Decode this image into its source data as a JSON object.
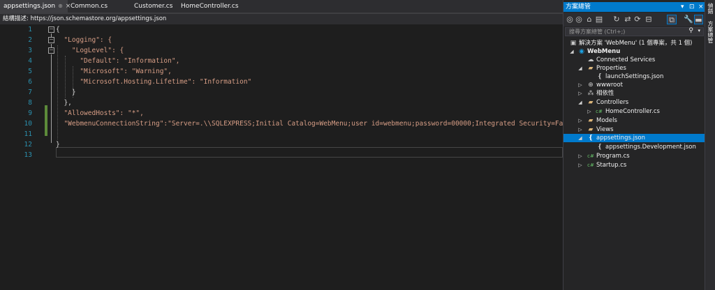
{
  "tabs": [
    {
      "label": "appsettings.json",
      "active": true
    },
    {
      "label": "Common.cs"
    },
    {
      "label": "Customer.cs"
    },
    {
      "label": "HomeController.cs"
    }
  ],
  "tab_pin_glyph": "⊕",
  "tab_close_glyph": "×",
  "schema": "結構描述:  https://json.schemastore.org/appsettings.json",
  "editor": {
    "line_numbers": [
      "1",
      "2",
      "3",
      "4",
      "5",
      "6",
      "7",
      "8",
      "9",
      "10",
      "11",
      "12",
      "13"
    ],
    "lines": [
      "{",
      "  \"Logging\": {",
      "    \"LogLevel\": {",
      "      \"Default\": \"Information\",",
      "      \"Microsoft\": \"Warning\",",
      "      \"Microsoft.Hosting.Lifetime\": \"Information\"",
      "    }",
      "  },",
      "  \"AllowedHosts\": \"*\",",
      "  \"WebmenuConnectionString\":\"Server=.\\\\SQLEXPRESS;Initial Catalog=WebMenu;user id=webmenu;password=00000;Integrated Security=False\"",
      "",
      "}",
      ""
    ]
  },
  "solution_explorer": {
    "title": "方案總管",
    "title_buttons": [
      "▾",
      "⊡",
      "×"
    ],
    "search_placeholder": "搜尋方案總管 (Ctrl+;)",
    "tree": [
      {
        "label": "解決方案 'WebMenu' (1 個專案，共 1 個)",
        "icon": "solution-icon",
        "depth": 0,
        "arrow": ""
      },
      {
        "label": "WebMenu",
        "icon": "web-project-icon",
        "depth": 1,
        "arrow": "◢",
        "bold": true
      },
      {
        "label": "Connected Services",
        "icon": "connected-services-icon",
        "depth": 2,
        "arrow": ""
      },
      {
        "label": "Properties",
        "icon": "properties-folder-icon",
        "depth": 2,
        "arrow": "◢"
      },
      {
        "label": "launchSettings.json",
        "icon": "json-file-icon",
        "depth": 3,
        "arrow": ""
      },
      {
        "label": "wwwroot",
        "icon": "globe-icon",
        "depth": 2,
        "arrow": "▷"
      },
      {
        "label": "相依性",
        "icon": "dependencies-icon",
        "depth": 2,
        "arrow": "▷"
      },
      {
        "label": "Controllers",
        "icon": "folder-icon",
        "depth": 2,
        "arrow": "◢"
      },
      {
        "label": "HomeController.cs",
        "icon": "csharp-file-icon",
        "depth": 3,
        "arrow": "▷"
      },
      {
        "label": "Models",
        "icon": "folder-icon",
        "depth": 2,
        "arrow": "▷"
      },
      {
        "label": "Views",
        "icon": "folder-icon",
        "depth": 2,
        "arrow": "▷"
      },
      {
        "label": "appsettings.json",
        "icon": "json-file-icon",
        "depth": 2,
        "arrow": "◢",
        "selected": true
      },
      {
        "label": "appsettings.Development.json",
        "icon": "json-file-icon",
        "depth": 3,
        "arrow": ""
      },
      {
        "label": "Program.cs",
        "icon": "csharp-file-icon",
        "depth": 2,
        "arrow": "▷"
      },
      {
        "label": "Startup.cs",
        "icon": "csharp-file-icon",
        "depth": 2,
        "arrow": "▷"
      }
    ]
  },
  "side_tabs": [
    "偵錯",
    "方案總管"
  ],
  "colors": {
    "accent": "#007acc",
    "editor_bg": "#1e1e1e",
    "string": "#d69d85",
    "line_number": "#2b91af",
    "change_marker": "#5c8a3a"
  }
}
